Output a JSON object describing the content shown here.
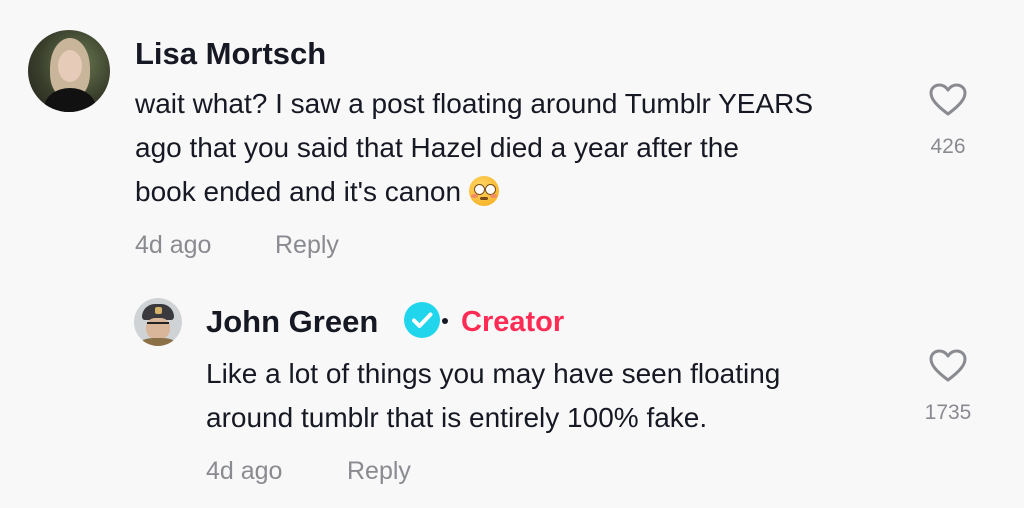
{
  "comments": {
    "main": {
      "username": "Lisa Mortsch",
      "text_lines": [
        "wait what? I saw a post floating around Tumblr YEARS",
        "ago that you said that Hazel died a year after the",
        "book ended and it's canon"
      ],
      "emoji": "flushed-face-emoji",
      "timestamp": "4d ago",
      "reply_label": "Reply",
      "like_count": "426"
    },
    "reply": {
      "username": "John Green",
      "verified": true,
      "badge_label": "Creator",
      "text_lines": [
        "Like a lot of things you may have seen floating",
        "around tumblr that is entirely 100% fake."
      ],
      "timestamp": "4d ago",
      "reply_label": "Reply",
      "like_count": "1735"
    }
  },
  "colors": {
    "background": "#f8f8f8",
    "text_primary": "#161823",
    "text_secondary": "#8a8b91",
    "creator_accent": "#fe2c55",
    "verified_badge": "#20d5ec"
  },
  "icons": {
    "like": "heart-outline-icon",
    "verified": "verified-check-icon"
  }
}
